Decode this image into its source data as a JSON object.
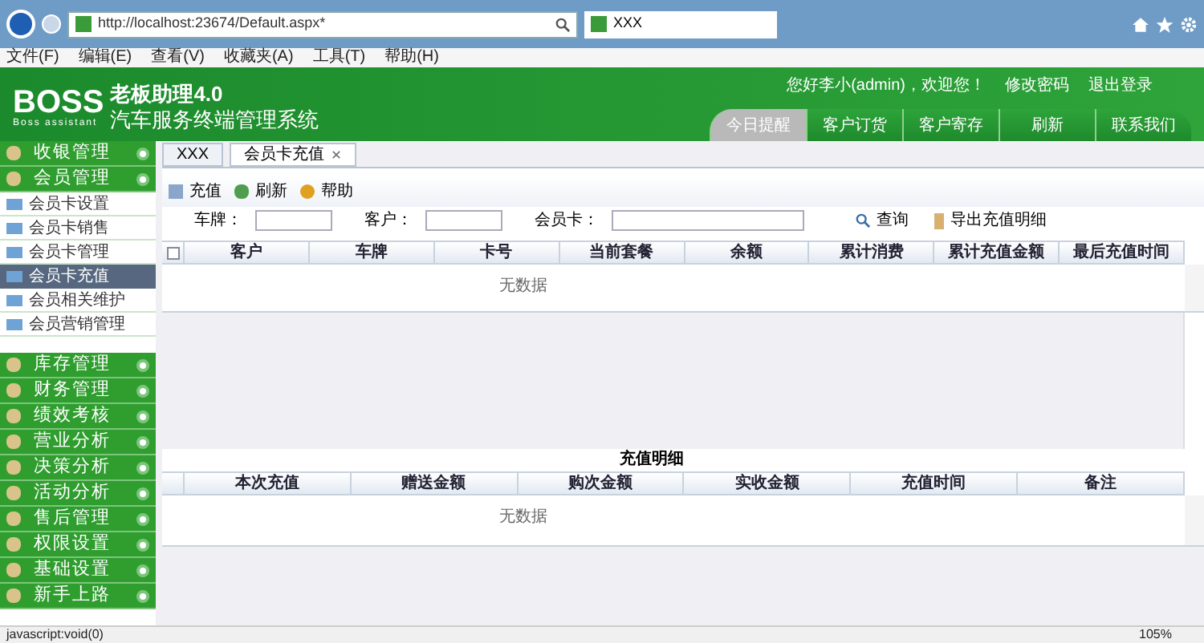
{
  "browser": {
    "url": "http://localhost:23674/Default.aspx*",
    "tab_title": "XXX",
    "menu": [
      "文件(F)",
      "编辑(E)",
      "查看(V)",
      "收藏夹(A)",
      "工具(T)",
      "帮助(H)"
    ],
    "status_text": "javascript:void(0)",
    "zoom": "105%"
  },
  "header": {
    "logo": "BOSS",
    "logo_sub": "Boss assistant",
    "title": "老板助理4.0",
    "subtitle": "汽车服务终端管理系统",
    "welcome": "您好李小(admin)，欢迎您！",
    "links": [
      "修改密码",
      "退出登录"
    ],
    "nav": [
      {
        "label": "今日提醒",
        "selected": true
      },
      {
        "label": "客户订货",
        "selected": false
      },
      {
        "label": "客户寄存",
        "selected": false
      },
      {
        "label": "刷新",
        "selected": false
      },
      {
        "label": "联系我们",
        "selected": false
      }
    ]
  },
  "sidebar": {
    "groups": [
      {
        "label": "收银管理"
      },
      {
        "label": "会员管理",
        "children": [
          {
            "label": "会员卡设置",
            "selected": false
          },
          {
            "label": "会员卡销售",
            "selected": false
          },
          {
            "label": "会员卡管理",
            "selected": false
          },
          {
            "label": "会员卡充值",
            "selected": true
          },
          {
            "label": "会员相关维护",
            "selected": false
          },
          {
            "label": "会员营销管理",
            "selected": false
          }
        ]
      },
      {
        "label": "库存管理"
      },
      {
        "label": "财务管理"
      },
      {
        "label": "绩效考核"
      },
      {
        "label": "营业分析"
      },
      {
        "label": "决策分析"
      },
      {
        "label": "活动分析"
      },
      {
        "label": "售后管理"
      },
      {
        "label": "权限设置"
      },
      {
        "label": "基础设置"
      },
      {
        "label": "新手上路"
      }
    ]
  },
  "content": {
    "tabs": [
      {
        "label": "XXX",
        "selected": false,
        "closable": false
      },
      {
        "label": "会员卡充值",
        "selected": true,
        "closable": true
      }
    ],
    "toolbar": [
      "充值",
      "刷新",
      "帮助"
    ],
    "filters": [
      {
        "label": "车牌："
      },
      {
        "label": "客户："
      },
      {
        "label": "会员卡："
      }
    ],
    "search_button": "查询",
    "export_button": "导出充值明细",
    "table": {
      "select_all_checked": false,
      "columns": [
        "客户",
        "车牌",
        "卡号",
        "当前套餐",
        "余额",
        "累计消费",
        "累计充值金额",
        "最后充值时间"
      ],
      "empty_text": "无数据"
    },
    "detail": {
      "title": "充值明细",
      "columns": [
        "本次充值",
        "赠送金额",
        "购次金额",
        "实收金额",
        "充值时间",
        "备注"
      ],
      "empty_text": "无数据"
    }
  }
}
